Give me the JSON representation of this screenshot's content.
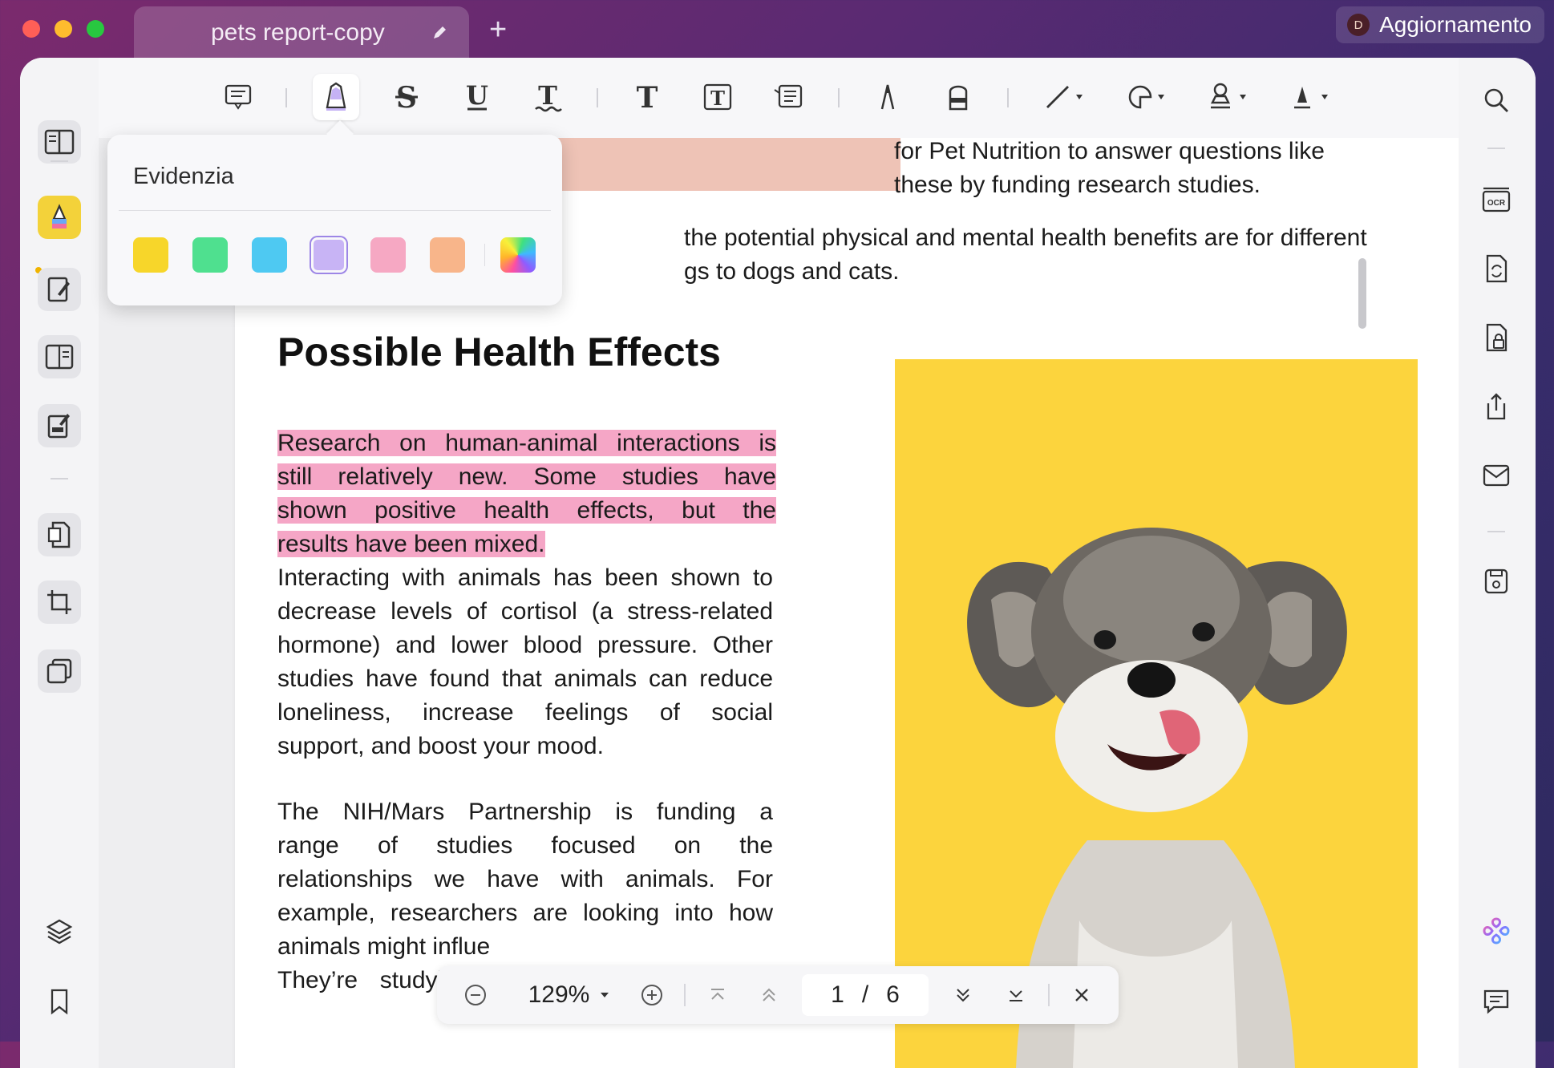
{
  "window": {
    "tab_title": "pets report-copy",
    "update_label": "Aggiornamento",
    "update_avatar_letter": "D"
  },
  "highlight_popover": {
    "title": "Evidenzia",
    "colors": [
      "#f7d62a",
      "#4fe08f",
      "#4ec9f2",
      "#c8b4f5",
      "#f6a8c3",
      "#f8b58a",
      "gradient"
    ],
    "selected_index": 3
  },
  "document": {
    "top_right_lines": [
      "for Pet Nutrition to answer questions like",
      "these by funding research studies."
    ],
    "mid_lines": [
      "the potential physical and mental health benefits are for different",
      "gs to dogs and cats."
    ],
    "heading": "Possible Health Effects",
    "highlighted_paragraph": [
      "Research on human-animal interactions is",
      "still relatively new. Some studies have",
      "shown positive health effects, but the",
      "results have been mixed."
    ],
    "paragraph_2": [
      "Interacting with animals has been shown to",
      "decrease levels of cortisol (a stress-related",
      "hormone) and lower blood pressure. Other",
      "studies have found that animals can reduce",
      "loneliness, increase feelings of social",
      "support, and boost your mood."
    ],
    "paragraph_3": [
      "The NIH/Mars Partnership is funding a",
      "range of studies focused on the",
      "relationships we have with animals. For",
      "example, researchers are looking into how",
      "animals might influe",
      "They’re studying animal interactions with"
    ]
  },
  "navigation": {
    "zoom": "129%",
    "current_page": "1",
    "separator": "/",
    "total_pages": "6"
  }
}
